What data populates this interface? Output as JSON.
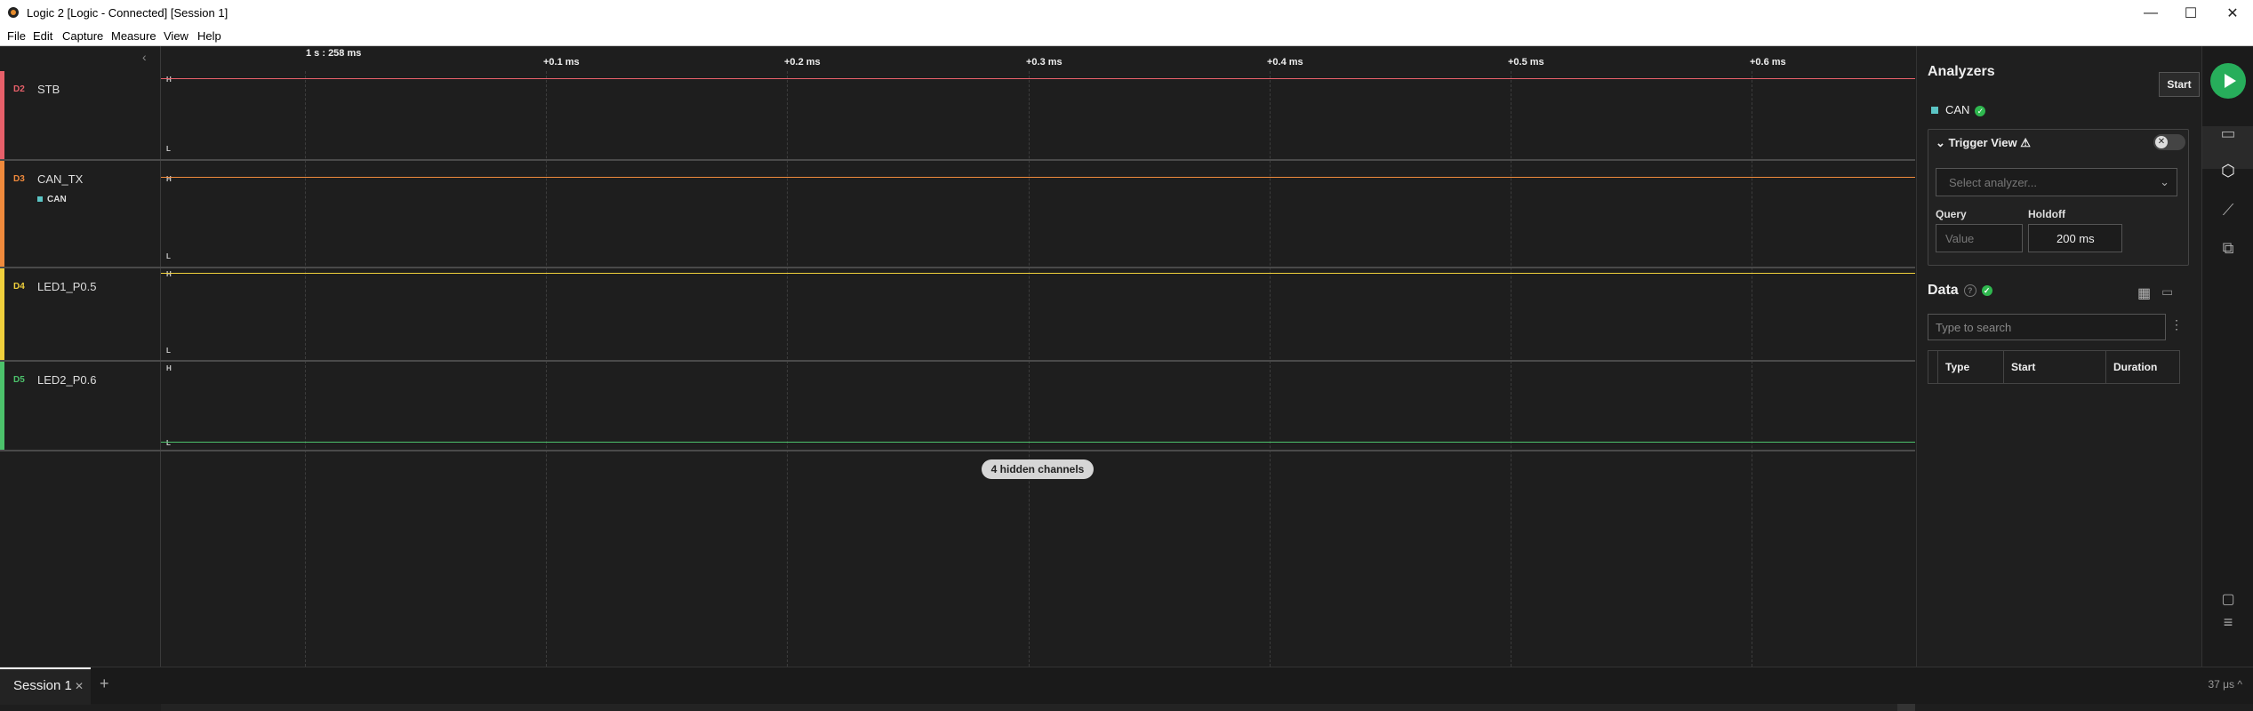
{
  "titlebar": {
    "title": "Logic 2 [Logic - Connected] [Session 1]",
    "minimize": "—",
    "maximize": "☐",
    "close": "✕"
  },
  "menu": [
    "File",
    "Edit",
    "Capture",
    "Measure",
    "View",
    "Help"
  ],
  "timeaxis": {
    "origin": "1 s : 258 ms",
    "ticks": [
      "+0.1 ms",
      "+0.2 ms",
      "+0.3 ms",
      "+0.4 ms",
      "+0.5 ms",
      "+0.6 ms"
    ]
  },
  "channels": [
    {
      "id": "D2",
      "name": "STB",
      "color": "#e8606a",
      "level": "H"
    },
    {
      "id": "D3",
      "name": "CAN_TX",
      "color": "#f08a3c",
      "level": "H",
      "analyzer": "CAN"
    },
    {
      "id": "D4",
      "name": "LED1_P0.5",
      "color": "#f0d03c",
      "level": "H"
    },
    {
      "id": "D5",
      "name": "LED2_P0.6",
      "color": "#4cc26b",
      "level": "L"
    }
  ],
  "level_labels": {
    "high": "H",
    "low": "L"
  },
  "hidden_channels": "4 hidden channels",
  "panel": {
    "title": "Analyzers",
    "start_tooltip": "Start",
    "analyzer": "CAN",
    "trigger": {
      "title": "Trigger View",
      "select_placeholder": "Select analyzer...",
      "query_label": "Query",
      "query_placeholder": "Value",
      "holdoff_label": "Holdoff",
      "holdoff_value": "200 ms"
    },
    "data": {
      "title": "Data",
      "search_placeholder": "Type to search",
      "columns": [
        "Type",
        "Start",
        "Duration"
      ]
    }
  },
  "tabs": {
    "session": "Session 1",
    "add": "+"
  },
  "status": "37 μs ^"
}
